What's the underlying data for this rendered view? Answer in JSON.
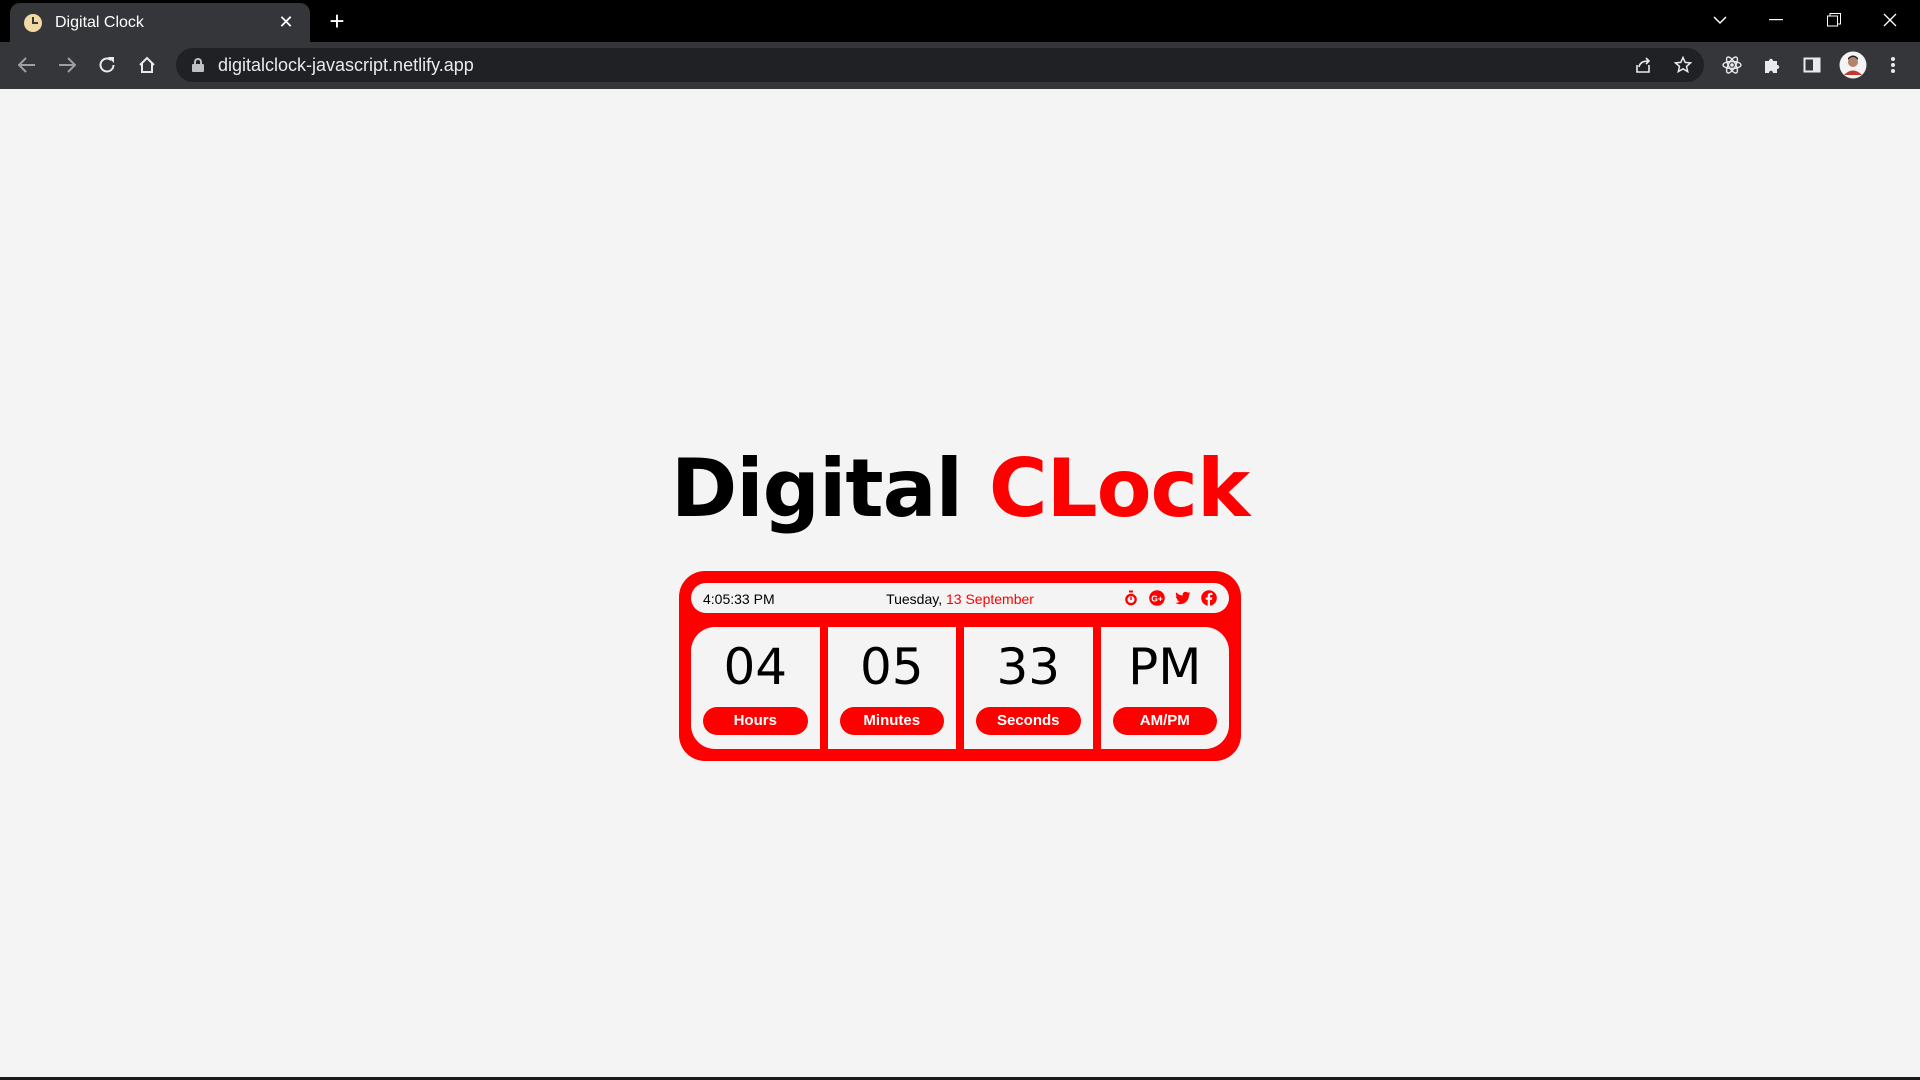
{
  "browser": {
    "tab_title": "Digital Clock",
    "tab_close": "✕",
    "new_tab": "+",
    "url": "digitalclock-javascript.netlify.app"
  },
  "page": {
    "heading_part1": "Digital",
    "heading_part2": "CLock",
    "accent_color": "#ff0000"
  },
  "clock": {
    "current_time": "4:05:33 PM",
    "weekday": "Tuesday,",
    "date": "13 September",
    "social_icons": [
      "stopwatch-icon",
      "google-plus-icon",
      "twitter-icon",
      "facebook-icon"
    ],
    "units": [
      {
        "value": "04",
        "label": "Hours"
      },
      {
        "value": "05",
        "label": "Minutes"
      },
      {
        "value": "33",
        "label": "Seconds"
      },
      {
        "value": "PM",
        "label": "AM/PM"
      }
    ]
  }
}
